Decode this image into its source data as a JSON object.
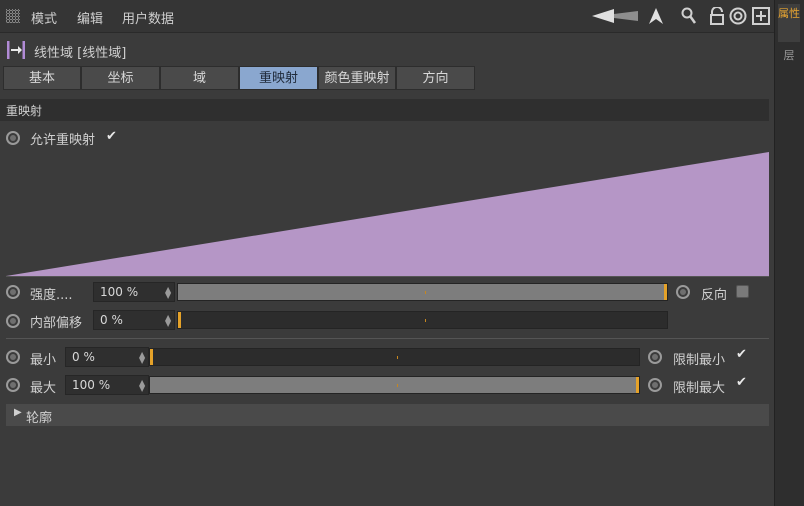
{
  "menu": [
    "模式",
    "编辑",
    "用户数据"
  ],
  "object": {
    "title": "线性域 [线性域]"
  },
  "tabs": [
    "基本",
    "坐标",
    "域",
    "重映射",
    "颜色重映射",
    "方向"
  ],
  "active_tab": "重映射",
  "section": {
    "title": "重映射"
  },
  "enable_remap": {
    "label": "允许重映射",
    "checked": true
  },
  "strength": {
    "label": "强度....",
    "value": "100 %",
    "fill": 1.0
  },
  "reverse": {
    "label": "反向",
    "checked": false
  },
  "inner_offset": {
    "label": "内部偏移",
    "value": "0 %",
    "fill": 0.0
  },
  "min": {
    "label": "最小",
    "value": "0 %",
    "fill": 0.0
  },
  "clamp_min": {
    "label": "限制最小",
    "checked": true
  },
  "max": {
    "label": "最大",
    "value": "100 %",
    "fill": 1.0
  },
  "clamp_max": {
    "label": "限制最大",
    "checked": true
  },
  "contour": {
    "label": "轮廓"
  },
  "check_glyph": "✔",
  "right_tabs": [
    "属性",
    "层"
  ],
  "colors": {
    "curve_fill": "#b596c6",
    "accent": "#e5a229",
    "active_tab": "#8aa7cf",
    "right_tab_active": "#e8a531"
  }
}
